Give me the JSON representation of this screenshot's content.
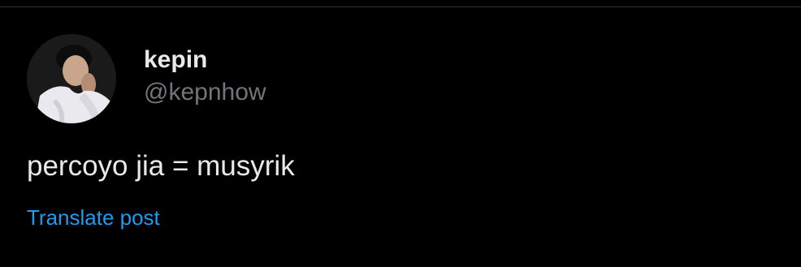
{
  "post": {
    "author": {
      "display_name": "kepin",
      "handle": "@kepnhow"
    },
    "text": "percoyo jia = musyrik",
    "translate_label": "Translate post"
  },
  "colors": {
    "background": "#000000",
    "primary_text": "#e7e9ea",
    "secondary_text": "#71767b",
    "link": "#1d9bf0",
    "divider": "#2f3336"
  }
}
